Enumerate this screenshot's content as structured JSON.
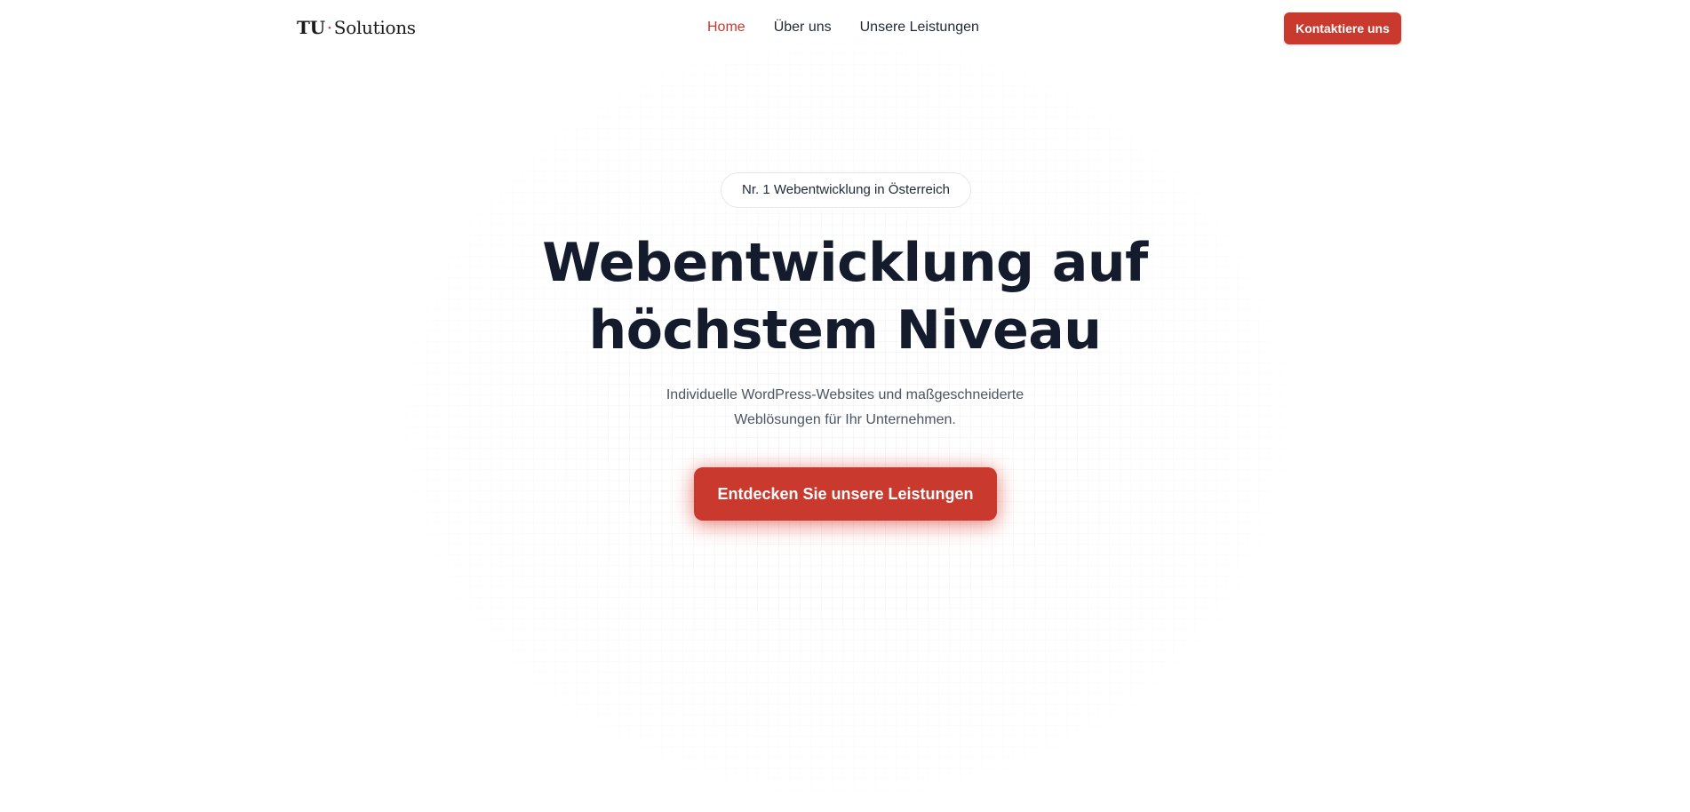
{
  "header": {
    "logo": {
      "part1": "TU",
      "separator": "·",
      "part2": "Solutions"
    },
    "nav": [
      {
        "label": "Home",
        "active": true
      },
      {
        "label": "Über uns",
        "active": false
      },
      {
        "label": "Unsere Leistungen",
        "active": false
      }
    ],
    "contact_label": "Kontaktiere uns"
  },
  "hero": {
    "badge": "Nr. 1 Webentwicklung in Österreich",
    "headline_line1": "Webentwicklung auf",
    "headline_line2": "höchstem Niveau",
    "subtitle_line1": "Individuelle WordPress-Websites und maßgeschneiderte",
    "subtitle_line2": "Weblösungen für Ihr Unternehmen.",
    "cta_label": "Entdecken Sie unsere Leistungen"
  },
  "colors": {
    "accent": "#c9392d",
    "text_dark": "#141b2d",
    "text_muted": "#4b5563",
    "background": "#ffffff"
  }
}
